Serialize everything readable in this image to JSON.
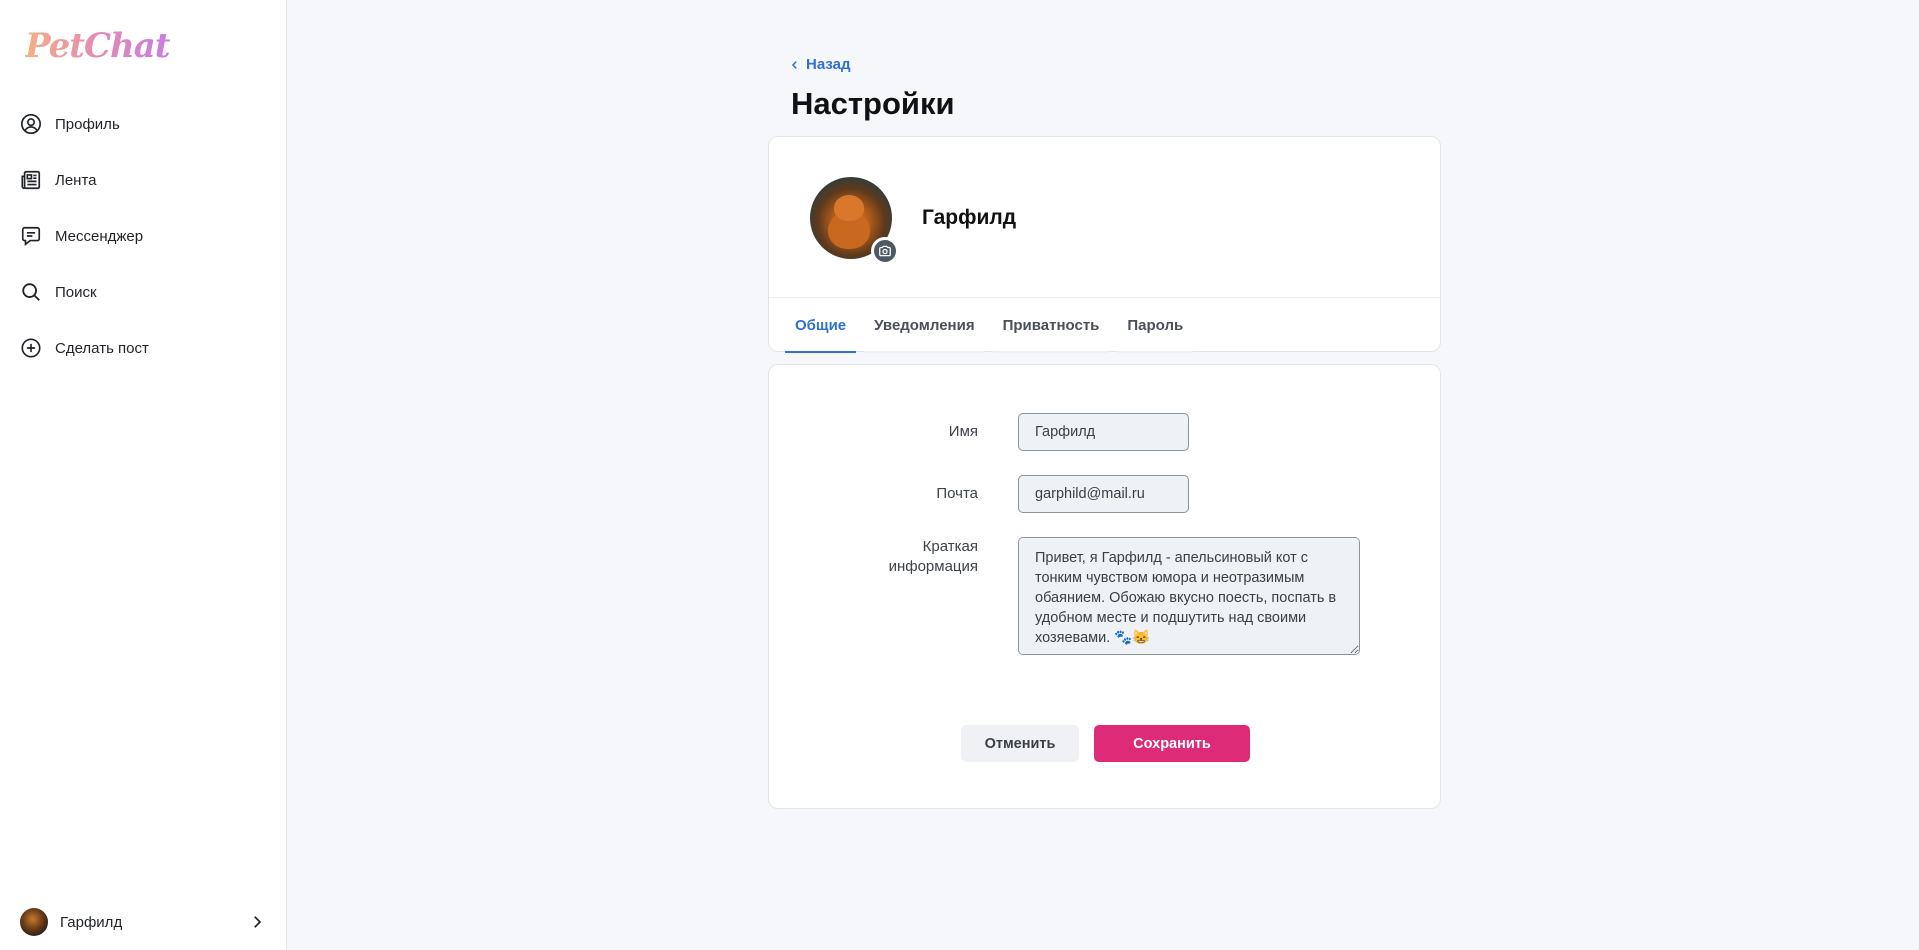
{
  "app": {
    "logo": "PetChat",
    "accent": "#2f6fd6",
    "brand_pink": "#dd2b77"
  },
  "sidebar": {
    "items": [
      {
        "label": "Профиль",
        "icon": "user-circle-icon"
      },
      {
        "label": "Лента",
        "icon": "newspaper-icon"
      },
      {
        "label": "Мессенджер",
        "icon": "chat-icon"
      },
      {
        "label": "Поиск",
        "icon": "search-icon"
      },
      {
        "label": "Сделать пост",
        "icon": "plus-circle-icon"
      }
    ],
    "user": {
      "name": "Гарфилд"
    }
  },
  "header": {
    "back_label": "Назад",
    "title": "Настройки"
  },
  "profile": {
    "name": "Гарфилд"
  },
  "tabs": [
    {
      "label": "Общие",
      "active": true
    },
    {
      "label": "Уведомления",
      "active": false
    },
    {
      "label": "Приватность",
      "active": false
    },
    {
      "label": "Пароль",
      "active": false
    }
  ],
  "form": {
    "name_label": "Имя",
    "name_value": "Гарфилд",
    "email_label": "Почта",
    "email_value": "garphild@mail.ru",
    "bio_label_line1": "Краткая",
    "bio_label_line2": "информация",
    "bio_value": "Привет, я Гарфилд - апельсиновый кот с тонким чувством юмора и неотразимым обаянием. Обожаю вкусно поесть, поспать в удобном месте и подшутить над своими хозяевами. 🐾😸",
    "cancel_label": "Отменить",
    "save_label": "Сохранить"
  }
}
